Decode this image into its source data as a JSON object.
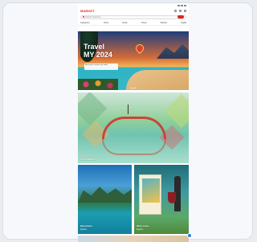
{
  "status": {
    "time": ""
  },
  "app": {
    "logo": "MARKET"
  },
  "search": {
    "placeholder": "Search products..."
  },
  "nav": {
    "items": [
      "Categories",
      "Home",
      "Deals",
      "Travel",
      "Fashion",
      "Digital",
      "Services"
    ]
  },
  "hero": {
    "title": "Travel",
    "subtitle": "MY 2024",
    "badge": "Book your summer trip today"
  },
  "feature": {
    "caption": "Destinations"
  },
  "tiles": [
    {
      "caption": "Mountains",
      "sub": "Explore"
    },
    {
      "caption": "Wine tours",
      "sub": "Explore"
    }
  ]
}
